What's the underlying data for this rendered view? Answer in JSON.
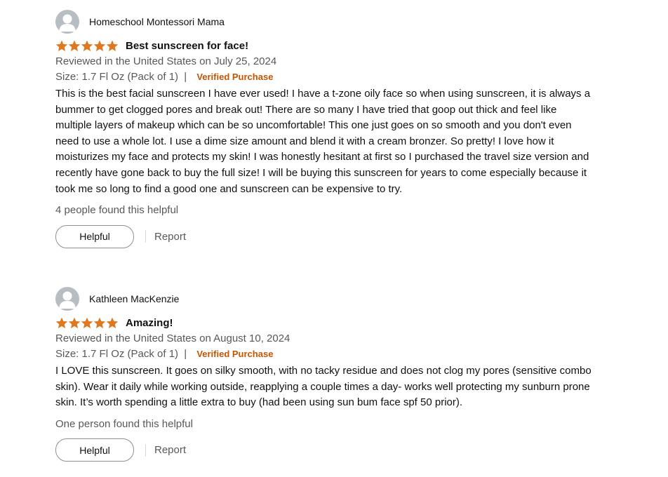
{
  "colors": {
    "star": "#de7921",
    "verified": "#c45500",
    "secondary_text": "#565959",
    "primary_text": "#0f1111"
  },
  "reviews": [
    {
      "author": "Homeschool Montessori Mama",
      "avatar_icon": "user-silhouette-icon",
      "rating": 5,
      "rating_max": 5,
      "title": "Best sunscreen for face!",
      "reviewed_line": "Reviewed in the United States on July 25, 2024",
      "size_line": "Size: 1.7 Fl Oz (Pack of 1)",
      "separator": "|",
      "verified": "Verified Purchase",
      "body": "This is the best facial sunscreen I have ever used! I have a t-zone oily face so when using sunscreen, it is always a bummer to get clogged pores and break out! There are so many I have tried that goop out thick and feel like multiple layers of makeup which can be so uncomfortable! This one just goes on so smooth and you don't even need to use a whole lot. I use a dime size amount and blend it with a cream bronzer. So pretty! I love how it moisturizes my face and protects my skin! I was honestly hesitant at first so I purchased the travel size version and recently have gone back to buy the full size! I will be buying this sunscreen for years to come especially because it took me so long to find a good one and sunscreen can be expensive to try.",
      "helpful_count": "4 people found this helpful",
      "helpful_button": "Helpful",
      "report_link": "Report"
    },
    {
      "author": "Kathleen MacKenzie",
      "avatar_icon": "user-silhouette-icon",
      "rating": 5,
      "rating_max": 5,
      "title": "Amazing!",
      "reviewed_line": "Reviewed in the United States on August 10, 2024",
      "size_line": "Size: 1.7 Fl Oz (Pack of 1)",
      "separator": "|",
      "verified": "Verified Purchase",
      "body": "I LOVE this sunscreen. It goes on silky smooth, with no tacky residue and does not clog my pores (sensitive combo skin). Wear it daily while working outside, reapplying a couple times a day- works well protecting my sunburn prone skin. It’s worth spending a little extra to buy (had been using sun bum face spf 50 prior).",
      "helpful_count": "One person found this helpful",
      "helpful_button": "Helpful",
      "report_link": "Report"
    }
  ]
}
